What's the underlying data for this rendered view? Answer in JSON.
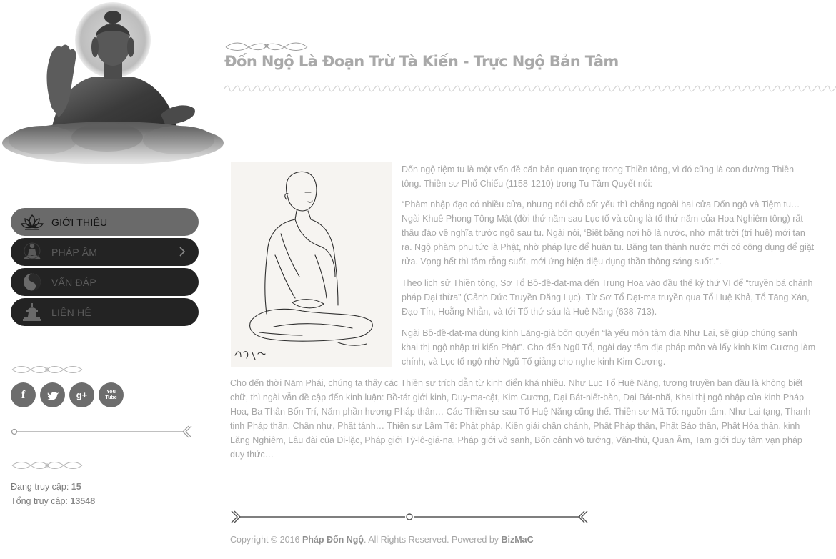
{
  "sidebar": {
    "menu": [
      {
        "label": "Giới thiệu",
        "icon": "lotus-icon",
        "active": true
      },
      {
        "label": "Pháp âm",
        "icon": "meditating-figure-icon",
        "has_submenu": true
      },
      {
        "label": "Vấn đáp",
        "icon": "koi-yin-yang-icon"
      },
      {
        "label": "Liên hệ",
        "icon": "stupa-icon"
      }
    ],
    "social": [
      {
        "name": "facebook-icon",
        "glyph": "f"
      },
      {
        "name": "twitter-icon",
        "glyph": "t"
      },
      {
        "name": "google-plus-icon",
        "glyph": "g+"
      },
      {
        "name": "youtube-icon",
        "glyph": "You Tube"
      }
    ],
    "stats": {
      "online_label": "Đang truy cập:",
      "online_value": "15",
      "total_label": "Tổng truy cập:",
      "total_value": "13548"
    }
  },
  "article": {
    "title": "Đốn Ngộ Là Đoạn Trừ Tà Kiến - Trực Ngộ Bản Tâm",
    "paragraphs": [
      "Đốn ngộ tiệm tu là một vấn đề căn bản quan trọng trong Thiền tông, vì đó cũng là con đường Thiền tông. Thiền sư Phổ Chiếu (1158-1210) trong Tu Tâm Quyết nói:",
      "“Phàm nhập đạo có nhiều cửa, nhưng nói chỗ cốt yếu thì chẳng ngoài hai cửa Đốn ngộ và Tiệm tu… Ngài Khuê Phong Tông Mật (đời thứ năm sau Lục tổ và cũng là tổ thứ năm của Hoa Nghiêm tông) rất thấu đáo về nghĩa trước ngộ sau tu. Ngài nói, ‘Biết băng nơi hồ là nước, nhờ mặt trời (trí huệ) mới tan ra. Ngộ phàm phu tức là Phật, nhờ pháp lực để huân tu. Băng tan thành nước mới có công dụng để giặt rửa. Vọng hết thì tâm rỗng suốt, mới ứng hiện diệu dụng thần thông sáng suốt’.”.",
      "Theo lịch sử Thiền tông, Sơ Tổ Bồ-đề-đạt-ma đến Trung Hoa vào đầu thế kỷ thứ VI để “truyền bá chánh pháp Đại thừa” (Cảnh Đức Truyền Đăng Lục). Từ Sơ Tổ Đạt-ma truyền qua Tổ Huệ Khả, Tổ Tăng Xán, Đạo Tín, Hoằng Nhẫn, và tới Tổ thứ sáu là Huệ Năng (638-713).",
      "Ngài Bồ-đề-đạt-ma dùng kinh Lăng-già bốn quyển “là yếu môn tâm địa Như Lai, sẽ giúp chúng sanh khai thị ngộ nhập tri kiến Phật”. Cho đến Ngũ Tổ, ngài dạy tâm địa pháp môn và lấy kinh Kim Cương làm chính, và Lục tổ ngộ nhờ Ngũ Tổ giảng cho nghe kinh Kim Cương.",
      "Cho đến thời Năm Phái, chúng ta thấy các Thiền sư trích dẫn từ kinh điển khá nhiều. Như Lục Tổ Huệ Năng, tương truyền ban đầu là không biết chữ, thì ngài vẫn đề cập đến kinh luận: Bồ-tát giới kinh, Duy-ma-cật, Kim Cương, Đại Bát-niết-bàn, Đại Bát-nhã, Khai thị ngộ nhập của kinh Pháp Hoa, Ba Thân Bốn Trí, Năm phần hương Pháp thân… Các Thiền sư sau Tổ Huệ Năng cũng thế. Thiền sư Mã Tổ: nguồn tâm, Như Lai tạng, Thanh tịnh Pháp thân, Chân như, Phật tánh… Thiền sư Lâm Tế: Phật pháp, Kiến giải chân chánh, Phật Pháp thân, Phật Báo thân, Phật Hóa thân, kinh Lăng Nghiêm, Lâu đài của Di-lặc, Pháp giới Tỳ-lô-giá-na, Pháp giới vô sanh, Bốn cảnh vô tướng, Văn-thù, Quan Âm, Tam giới duy tâm vạn pháp duy thức…"
    ],
    "image_signature": "Minh Văn"
  },
  "footer": {
    "prefix": "Copyright © 2016 ",
    "brand": "Pháp Đốn Ngộ",
    "middle": ". All Rights Reserved. Powered by ",
    "powered": "BizMaC"
  },
  "colors": {
    "menu_bg": "#232323",
    "menu_active_bg": "#6a6a6a",
    "social_bg": "#6d6d6d",
    "text": "#a6a6a6"
  }
}
